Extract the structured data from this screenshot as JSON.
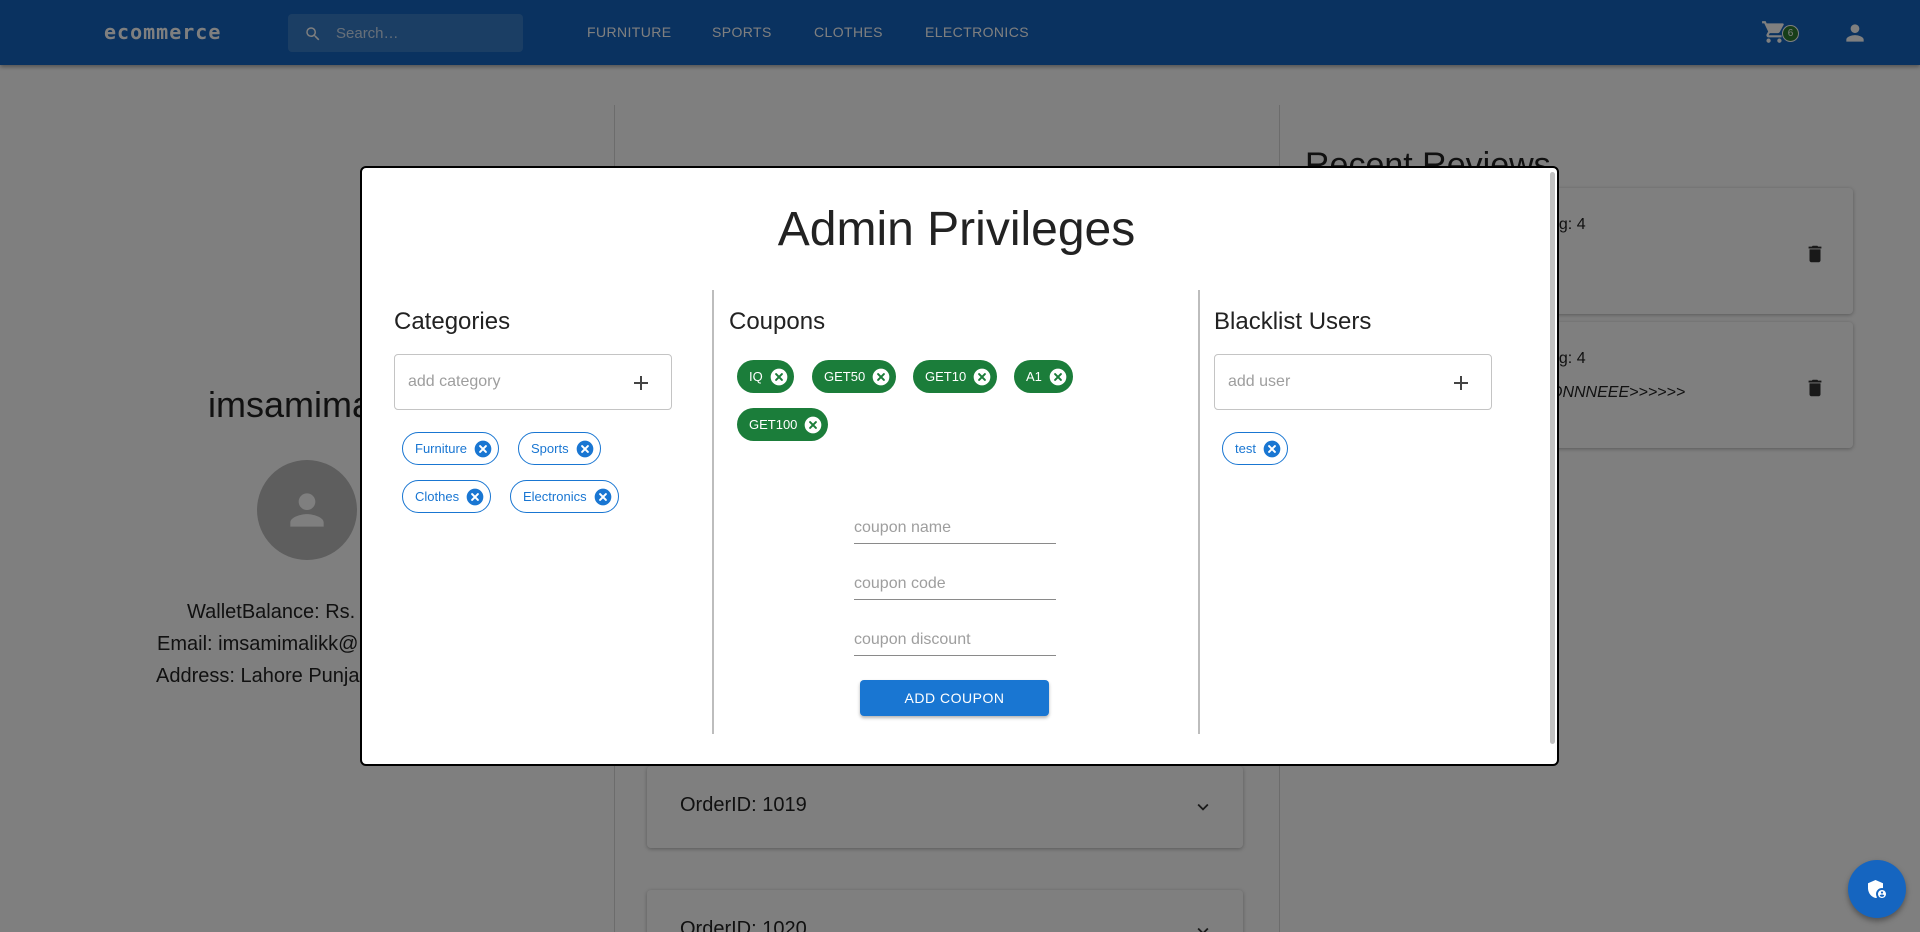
{
  "header": {
    "brand": "ecommerce",
    "search_placeholder": "Search…",
    "nav": [
      "FURNITURE",
      "SPORTS",
      "CLOTHES",
      "ELECTRONICS"
    ],
    "cart_count": "6"
  },
  "profile": {
    "name": "imsamima",
    "wallet": "WalletBalance: Rs.",
    "email": "Email: imsamimalikk@",
    "address": "Address: Lahore Punja"
  },
  "reviews": {
    "title": "Recent Reviews",
    "items": [
      {
        "rating": "ng: 4",
        "text": ""
      },
      {
        "rating": "ng: 4",
        "text": "ONNNEEE>>>>>>"
      }
    ]
  },
  "orders": [
    "OrderID: 1019",
    "OrderID: 1020"
  ],
  "modal": {
    "title": "Admin Privileges",
    "categories": {
      "title": "Categories",
      "placeholder": "add category",
      "chips": [
        "Furniture",
        "Sports",
        "Clothes",
        "Electronics"
      ]
    },
    "coupons": {
      "title": "Coupons",
      "chips": [
        "IQ",
        "GET50",
        "GET10",
        "A1",
        "GET100"
      ],
      "name_placeholder": "coupon name",
      "code_placeholder": "coupon code",
      "discount_placeholder": "coupon discount",
      "button": "ADD COUPON"
    },
    "blacklist": {
      "title": "Blacklist Users",
      "placeholder": "add user",
      "chips": [
        "test"
      ]
    }
  },
  "colors": {
    "appbar": "#1565c0",
    "primary": "#1976d2",
    "coupon_chip": "#1b7d3a"
  }
}
